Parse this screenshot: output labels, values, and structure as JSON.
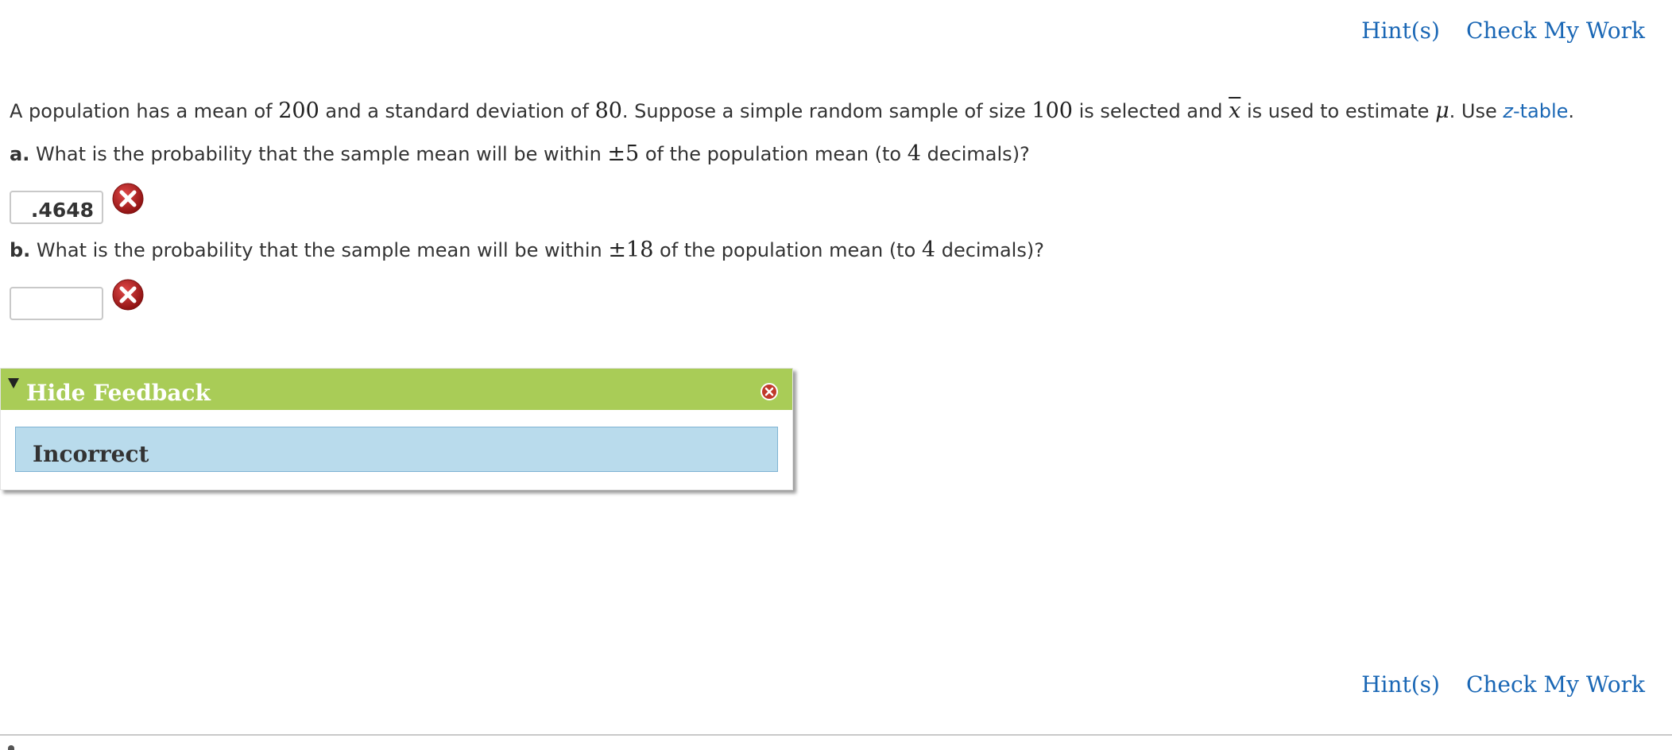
{
  "header": {
    "hints_label": "Hint(s)",
    "check_label": "Check My Work"
  },
  "footer": {
    "hints_label": "Hint(s)",
    "check_label": "Check My Work"
  },
  "problem": {
    "t1": "A population has a mean of ",
    "mean": "200",
    "t2": " and a standard deviation of ",
    "sd": "80",
    "t3": ". Suppose a simple random sample of size ",
    "n": "100",
    "t4": " is selected and ",
    "xbar": "x",
    "t5": " is used to estimate ",
    "mu": "μ",
    "t6": ". Use ",
    "ztable_z": "z",
    "ztable_rest": "-table",
    "t7": "."
  },
  "question_a": {
    "label": "a.",
    "t1": " What is the probability that the sample mean will be within ",
    "within": "±5",
    "t2": " of the population mean (to ",
    "decimals": "4",
    "t3": " decimals)?",
    "answer": ".4648",
    "status": "incorrect"
  },
  "question_b": {
    "label": "b.",
    "t1": " What is the probability that the sample mean will be within ",
    "within": "±18",
    "t2": " of the population mean (to ",
    "decimals": "4",
    "t3": " decimals)?",
    "answer": "",
    "status": "incorrect"
  },
  "feedback": {
    "toggle_label": "Hide Feedback",
    "result_text": "Incorrect"
  },
  "colors": {
    "link": "#1a67b5",
    "feedback_header": "#a9cc57",
    "feedback_body": "#b9dbec",
    "error_icon": "#b31b1b"
  },
  "icons": [
    "error-x-icon",
    "close-icon",
    "collapse-triangle-icon"
  ]
}
